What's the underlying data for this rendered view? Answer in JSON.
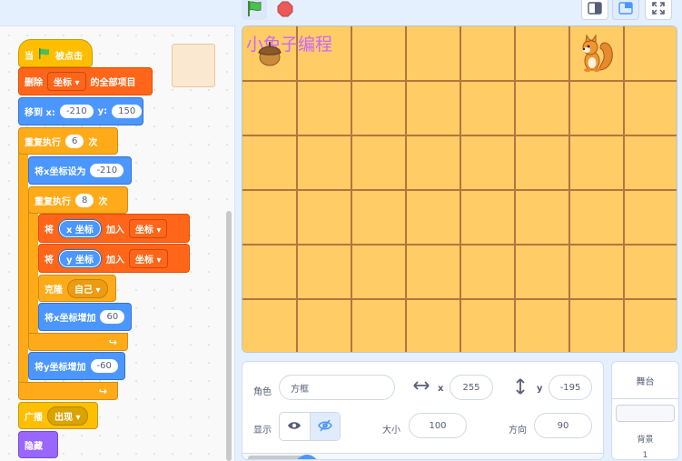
{
  "blocks": {
    "when_flag": {
      "pre": "当",
      "post": "被点击"
    },
    "delete_all": {
      "pre": "删除",
      "list": "坐标",
      "post": "的全部项目"
    },
    "goto_xy": {
      "label": "移到 x:",
      "x": "-210",
      "ylabel": "y:",
      "y": "150"
    },
    "repeat_outer": {
      "label": "重复执行",
      "count": "6",
      "unit": "次"
    },
    "set_x": {
      "label": "将x坐标设为",
      "value": "-210"
    },
    "repeat_inner": {
      "label": "重复执行",
      "count": "8",
      "unit": "次"
    },
    "add_x": {
      "pre": "将",
      "reporter": "x 坐标",
      "mid": "加入",
      "list": "坐标"
    },
    "add_y": {
      "pre": "将",
      "reporter": "y 坐标",
      "mid": "加入",
      "list": "坐标"
    },
    "clone": {
      "label": "克隆",
      "target": "自己"
    },
    "change_x": {
      "label": "将x坐标增加",
      "value": "60"
    },
    "change_y": {
      "label": "将y坐标增加",
      "value": "-60"
    },
    "broadcast": {
      "label": "广播",
      "message": "出现"
    },
    "hide": {
      "label": "隐藏"
    }
  },
  "stage": {
    "title": "小兔子编程",
    "bg_color": "#ffcc66",
    "grid_color": "#b5753f",
    "rows": 6,
    "cols": 8
  },
  "sprite_info": {
    "sprite_label": "角色",
    "sprite_name": "方框",
    "x_label": "x",
    "x_value": "255",
    "y_label": "y",
    "y_value": "-195",
    "show_label": "显示",
    "size_label": "大小",
    "size_value": "100",
    "direction_label": "方向",
    "direction_value": "90"
  },
  "stage_panel": {
    "title": "舞台",
    "backdrop_label": "背景",
    "backdrop_count": "1"
  },
  "icons": {
    "start": "green-flag-icon",
    "stop": "stop-icon",
    "acorn": "acorn-icon",
    "squirrel": "squirrel-icon"
  }
}
